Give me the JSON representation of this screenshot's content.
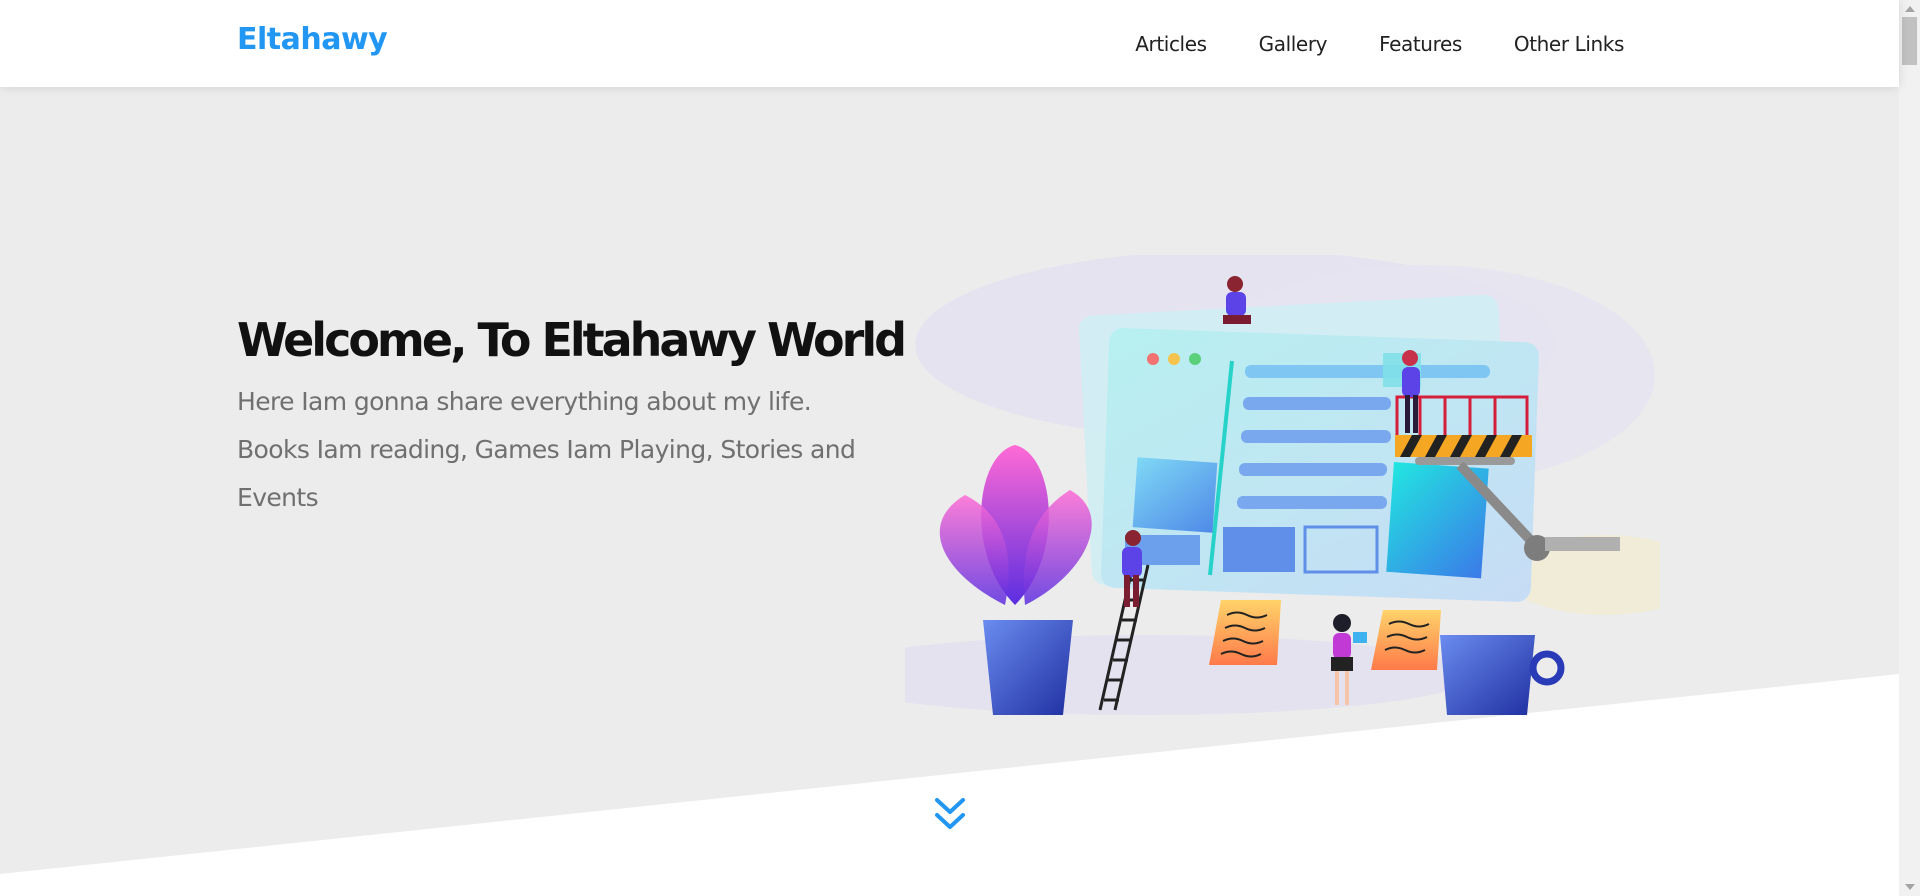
{
  "header": {
    "logo": "Eltahawy",
    "nav": [
      "Articles",
      "Gallery",
      "Features",
      "Other Links"
    ]
  },
  "hero": {
    "title": "Welcome, To Eltahawy World",
    "description": "Here Iam gonna share everything about my life. Books Iam reading, Games Iam Playing, Stories and Events"
  },
  "icons": {
    "go_down": "angle-double-down-icon"
  },
  "colors": {
    "brand": "#2196f3",
    "landing_bg": "#ececec",
    "text_dark": "#111111",
    "text_muted": "#707070"
  }
}
